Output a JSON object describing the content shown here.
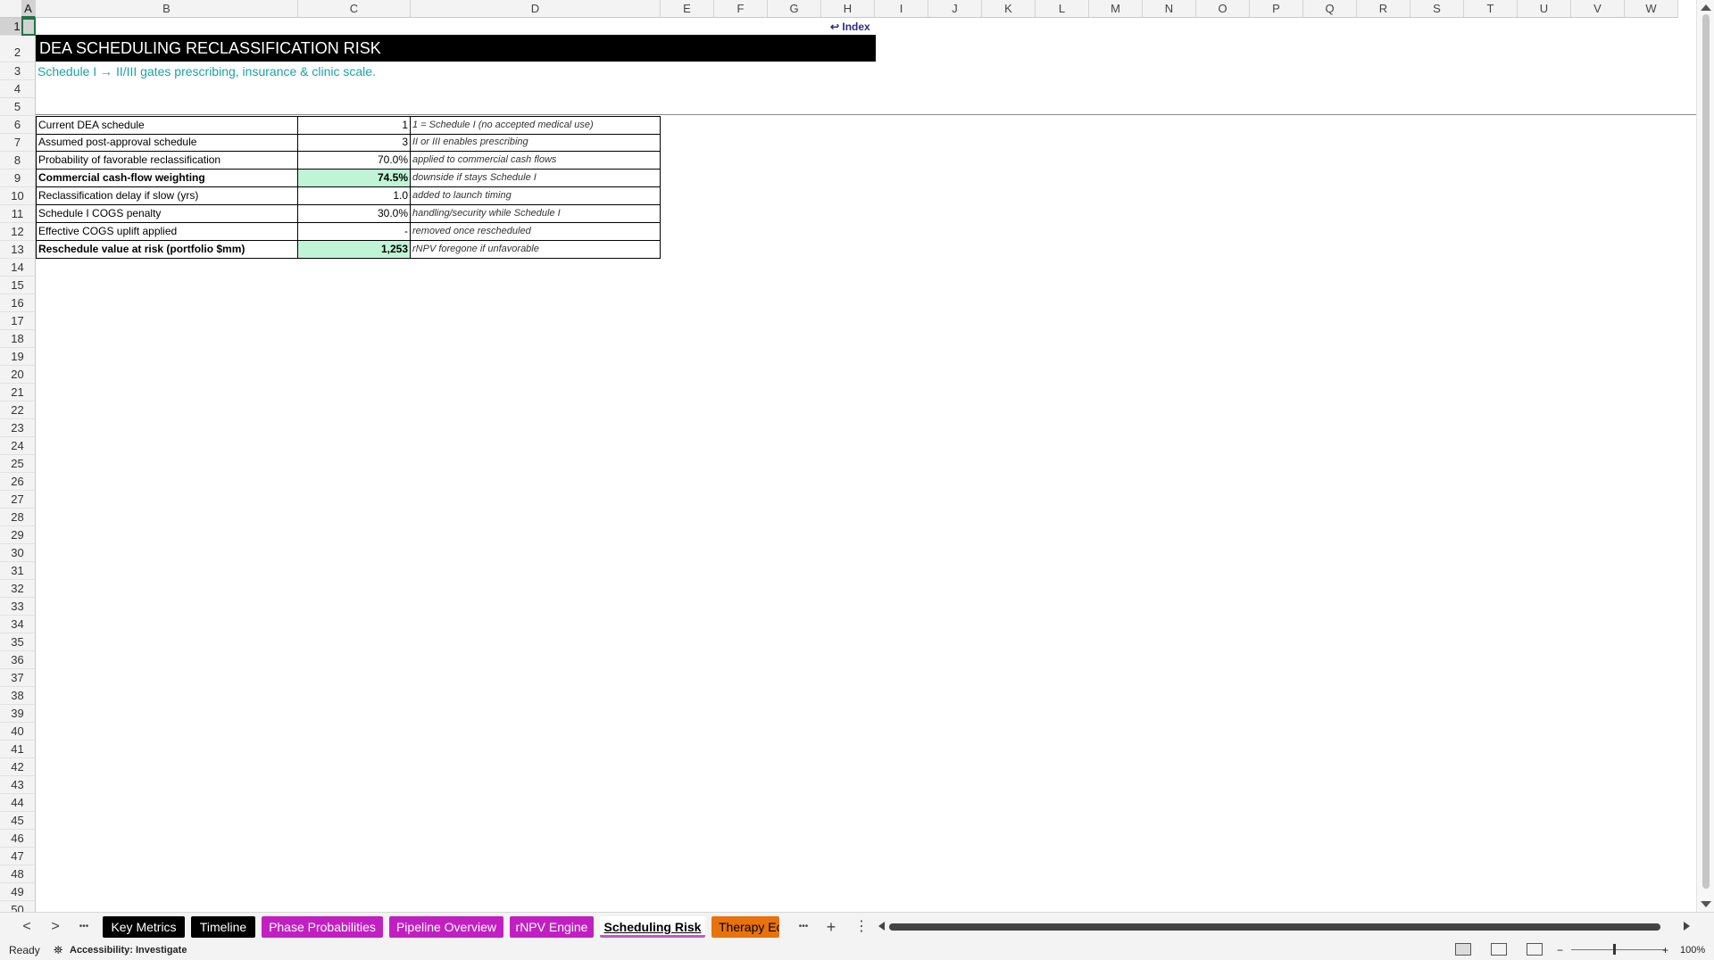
{
  "columns": [
    "A",
    "B",
    "C",
    "D",
    "E",
    "F",
    "G",
    "H",
    "I",
    "J",
    "K",
    "L",
    "M",
    "N",
    "O",
    "P",
    "Q",
    "R",
    "S",
    "T",
    "U",
    "V",
    "W"
  ],
  "rows": [
    "1",
    "2",
    "3",
    "4",
    "5",
    "6",
    "7",
    "8",
    "9",
    "10",
    "11",
    "12",
    "13",
    "14",
    "15",
    "16",
    "17",
    "18",
    "19",
    "20",
    "21",
    "22",
    "23",
    "24",
    "25",
    "26",
    "27",
    "28",
    "29",
    "30",
    "31",
    "32",
    "33",
    "34",
    "35",
    "36",
    "37",
    "38",
    "39",
    "40",
    "41",
    "42",
    "43",
    "44",
    "45",
    "46",
    "47",
    "48",
    "49",
    "50"
  ],
  "selected_cell": "A1",
  "index_link": "↩ Index",
  "title": "DEA SCHEDULING RECLASSIFICATION RISK",
  "subtitle": "Schedule I → II/III gates prescribing, insurance & clinic scale.",
  "table": [
    {
      "label": "Current DEA schedule",
      "value": "1",
      "note": "1 = Schedule I (no accepted medical use)",
      "highlight": false
    },
    {
      "label": "Assumed post-approval schedule",
      "value": "3",
      "note": "II or III enables prescribing",
      "highlight": false
    },
    {
      "label": "Probability of favorable reclassification",
      "value": "70.0%",
      "note": "applied to commercial cash flows",
      "highlight": false
    },
    {
      "label": "Commercial cash-flow weighting",
      "value": "74.5%",
      "note": "downside if stays Schedule I",
      "highlight": true
    },
    {
      "label": "Reclassification delay if slow (yrs)",
      "value": "1.0",
      "note": "added to launch timing",
      "highlight": false
    },
    {
      "label": "Schedule I COGS penalty",
      "value": "30.0%",
      "note": "handling/security while Schedule I",
      "highlight": false
    },
    {
      "label": "Effective COGS uplift applied",
      "value": "-",
      "note": "removed once rescheduled",
      "highlight": false
    },
    {
      "label": "Reschedule value at risk (portfolio $mm)",
      "value": "1,253",
      "note": "rNPV foregone if unfavorable",
      "highlight": true
    }
  ],
  "sheet_tabs": [
    {
      "label": "Key Metrics",
      "bg": "#000000",
      "fg": "#ffffff",
      "active": false
    },
    {
      "label": "Timeline",
      "bg": "#000000",
      "fg": "#ffffff",
      "active": false
    },
    {
      "label": "Phase Probabilities",
      "bg": "#c21fc2",
      "fg": "#ffffff",
      "active": false
    },
    {
      "label": "Pipeline Overview",
      "bg": "#c21fc2",
      "fg": "#ffffff",
      "active": false
    },
    {
      "label": "rNPV Engine",
      "bg": "#c21fc2",
      "fg": "#ffffff",
      "active": false
    },
    {
      "label": "Scheduling Risk",
      "bg": "#ffffff",
      "fg": "#000000",
      "active": true
    },
    {
      "label": "Therapy Ec",
      "bg": "#e8720c",
      "fg": "#000000",
      "active": false
    }
  ],
  "tab_nav": {
    "prev": "<",
    "next": ">",
    "more_left": "•••",
    "more_right": "•••",
    "add": "+",
    "options": "⋮"
  },
  "status": {
    "ready": "Ready",
    "accessibility": "Accessibility: Investigate",
    "zoom": "100%",
    "zoom_minus": "−",
    "zoom_plus": "+"
  }
}
